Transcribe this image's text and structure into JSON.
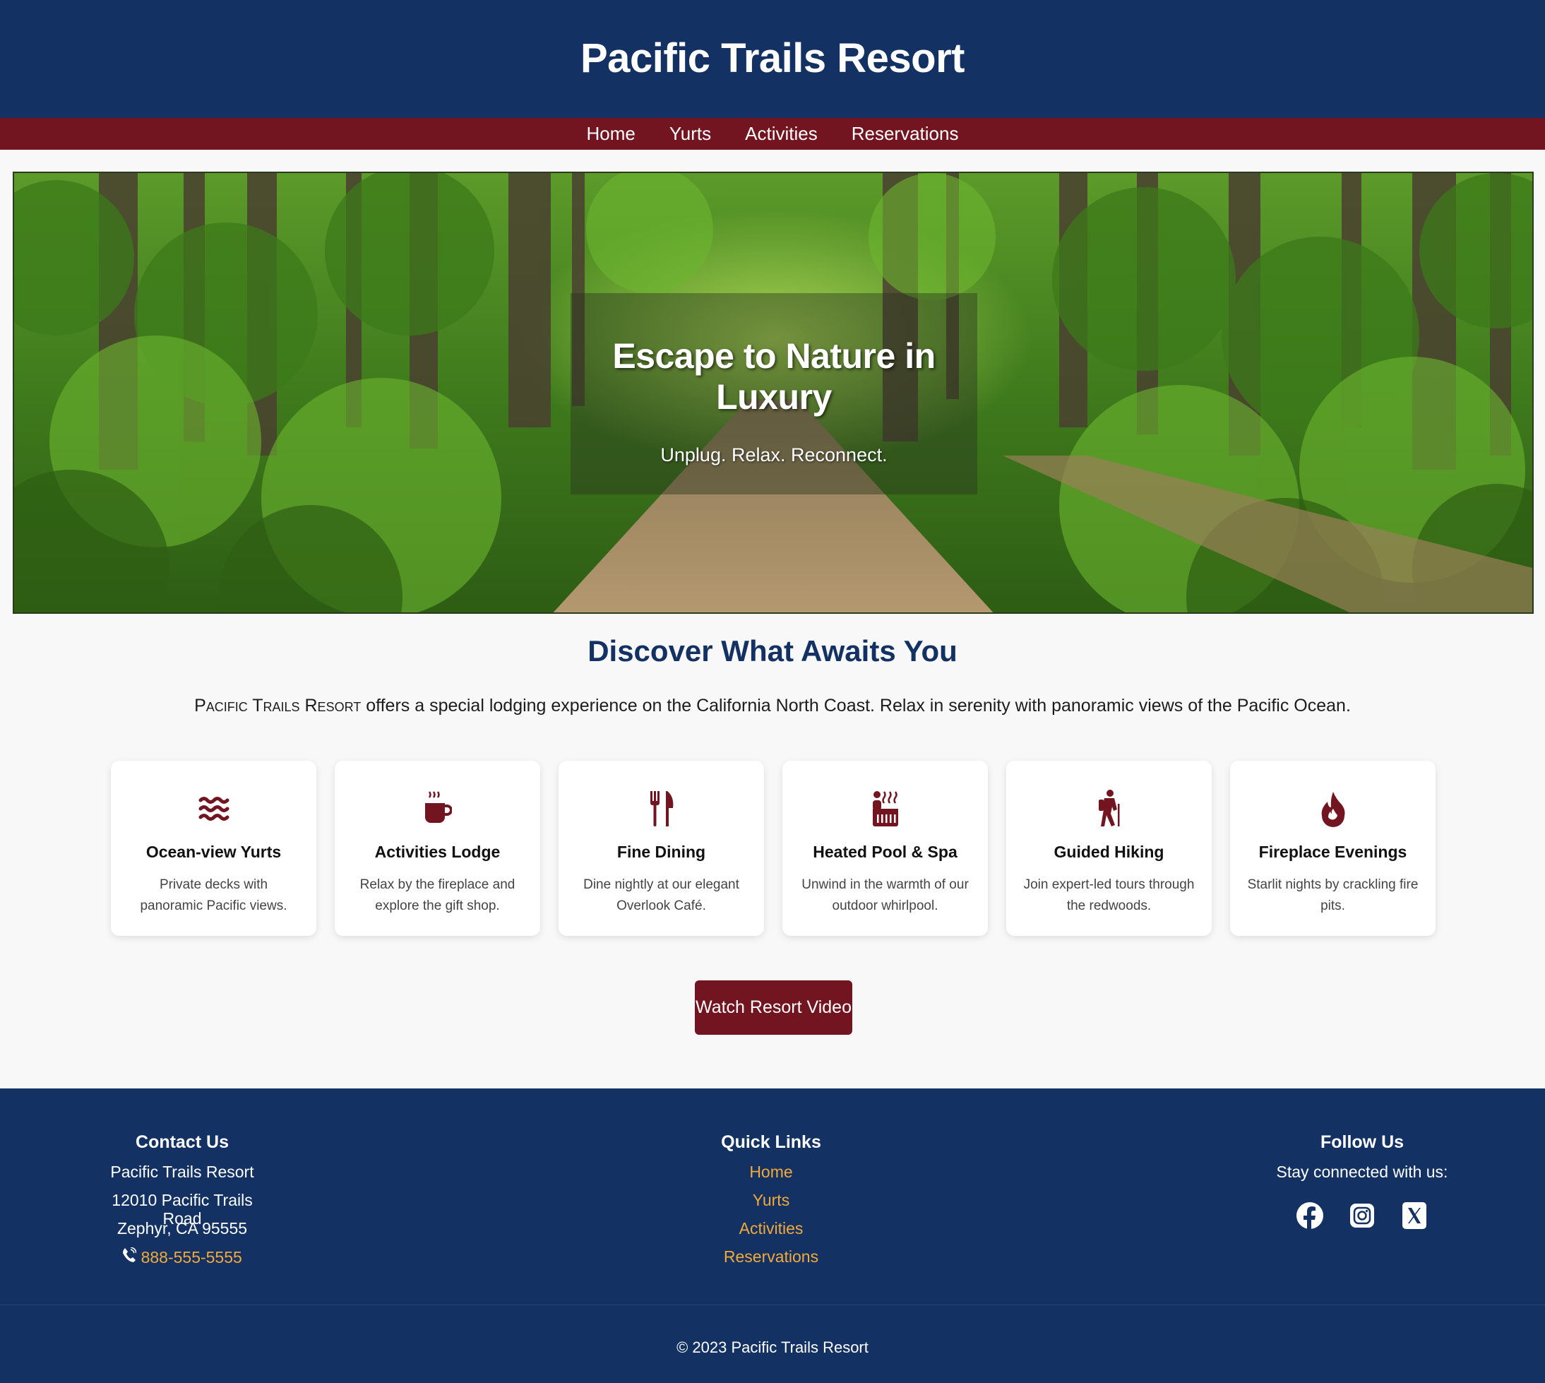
{
  "header": {
    "title": "Pacific Trails Resort"
  },
  "nav": {
    "items": [
      "Home",
      "Yurts",
      "Activities",
      "Reservations"
    ]
  },
  "hero": {
    "heading": "Escape to Nature in Luxury",
    "tagline": "Unplug. Relax. Reconnect."
  },
  "discover": {
    "title": "Discover What Awaits You",
    "intro_brand": "Pacific Trails Resort",
    "intro_text": " offers a special lodging experience on the California North Coast. Relax in serenity with panoramic views of the Pacific Ocean."
  },
  "features": [
    {
      "icon": "water-waves-icon",
      "title": "Ocean-view Yurts",
      "desc": "Private decks with panoramic Pacific views."
    },
    {
      "icon": "coffee-mug-icon",
      "title": "Activities Lodge",
      "desc": "Relax by the fireplace and explore the gift shop."
    },
    {
      "icon": "utensils-icon",
      "title": "Fine Dining",
      "desc": "Dine nightly at our elegant Overlook Café."
    },
    {
      "icon": "hot-tub-icon",
      "title": "Heated Pool & Spa",
      "desc": "Unwind in the warmth of our outdoor whirlpool."
    },
    {
      "icon": "hiker-icon",
      "title": "Guided Hiking",
      "desc": "Join expert-led tours through the redwoods."
    },
    {
      "icon": "fire-icon",
      "title": "Fireplace Evenings",
      "desc": "Starlit nights by crackling fire pits."
    }
  ],
  "video_button": "Watch Resort Video",
  "footer": {
    "contact": {
      "title": "Contact Us",
      "name": "Pacific Trails Resort",
      "street": "12010 Pacific Trails Road",
      "city": "Zephyr, CA 95555",
      "phone": "888-555-5555"
    },
    "links": {
      "title": "Quick Links",
      "items": [
        "Home",
        "Yurts",
        "Activities",
        "Reservations"
      ]
    },
    "follow": {
      "title": "Follow Us",
      "text": "Stay connected with us:"
    },
    "copyright": "© 2023 Pacific Trails Resort"
  },
  "colors": {
    "navy": "#133263",
    "maroon": "#731520",
    "link_gold": "#f2a93b",
    "background": "#f8f8f8"
  }
}
